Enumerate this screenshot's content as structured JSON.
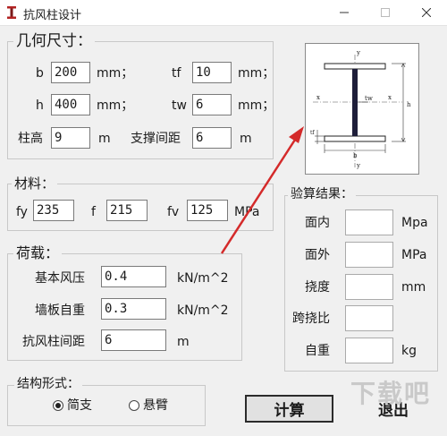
{
  "window": {
    "title": "抗风柱设计"
  },
  "dimensions": {
    "legend": "几何尺寸：",
    "b": {
      "label": "b",
      "value": "200",
      "unit": "mm；"
    },
    "tf": {
      "label": "tf",
      "value": "10",
      "unit": "mm；"
    },
    "h": {
      "label": "h",
      "value": "400",
      "unit": "mm；"
    },
    "tw": {
      "label": "tw",
      "value": "6",
      "unit": "mm；"
    },
    "column_height": {
      "label": "柱高",
      "value": "9",
      "unit": "m"
    },
    "support_spacing": {
      "label": "支撑间距",
      "value": "6",
      "unit": "m"
    }
  },
  "diagram": {
    "y": "y",
    "x": "x",
    "tw": "tw",
    "tf": "tf",
    "b": "b",
    "h": "h"
  },
  "material": {
    "legend": "材料：",
    "fy": {
      "label": "fy",
      "value": "235"
    },
    "f": {
      "label": "f",
      "value": "215"
    },
    "fv": {
      "label": "fv",
      "value": "125",
      "unit": "MPa"
    }
  },
  "loads": {
    "legend": "荷载：",
    "wind_pressure": {
      "label": "基本风压",
      "value": "0.4",
      "unit": "kN/m^2"
    },
    "wall_weight": {
      "label": "墙板自重",
      "value": "0.3",
      "unit": "kN/m^2"
    },
    "column_spacing": {
      "label": "抗风柱间距",
      "value": "6",
      "unit": "m"
    }
  },
  "results": {
    "legend": "验算结果：",
    "in_plane": {
      "label": "面内",
      "unit": "Mpa"
    },
    "out_plane": {
      "label": "面外",
      "unit": "MPa"
    },
    "deflection": {
      "label": "挠度",
      "unit": "mm"
    },
    "span_deflection_ratio": {
      "label": "跨挠比"
    },
    "self_weight": {
      "label": "自重",
      "unit": "kg"
    }
  },
  "structure": {
    "legend": "结构形式：",
    "options": [
      "简支",
      "悬臂"
    ],
    "selected": "简支"
  },
  "buttons": {
    "calculate": "计算",
    "exit": "退出"
  },
  "colors": {
    "annotation_arrow": "#d42a2a",
    "input_border": "#7a7a7a"
  }
}
